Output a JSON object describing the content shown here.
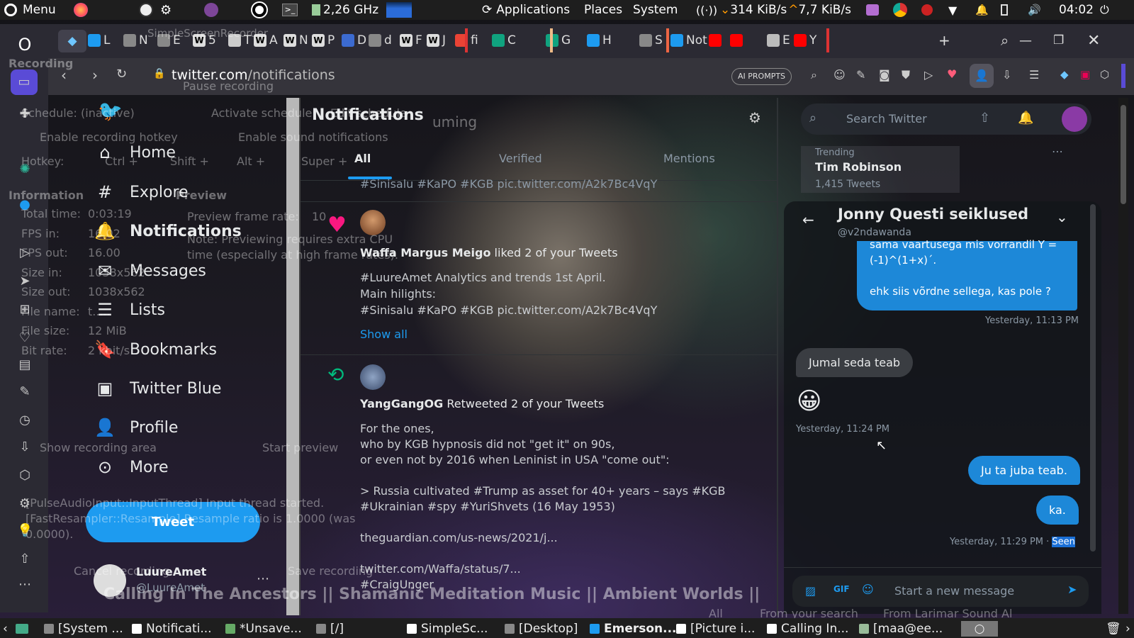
{
  "top_panel": {
    "menu_label": "Menu",
    "cpu_freq": "2,26 GHz",
    "apps": [
      "Applications",
      "Places",
      "System"
    ],
    "net_down": "314 KiB/s",
    "net_up": "7,7 KiB/s",
    "clock": "04:02"
  },
  "browser": {
    "tabs": [
      {
        "icon": "twitter",
        "label": "L"
      },
      {
        "icon": "globe",
        "label": "N"
      },
      {
        "icon": "tab",
        "label": "E"
      },
      {
        "icon": "wiki",
        "label": "5"
      },
      {
        "icon": "pp",
        "label": "T"
      },
      {
        "icon": "wiki",
        "label": "A"
      },
      {
        "icon": "wiki",
        "label": "N"
      },
      {
        "icon": "wiki",
        "label": "P"
      },
      {
        "icon": "x",
        "label": "D"
      },
      {
        "icon": "globe",
        "label": "d"
      },
      {
        "icon": "wiki",
        "label": "F"
      },
      {
        "icon": "wiki",
        "label": "J"
      },
      {
        "icon": "google",
        "label": "fi"
      },
      {
        "icon": "chatgpt",
        "label": "C"
      },
      {
        "icon": "chatgpt",
        "label": "G"
      },
      {
        "icon": "twitter",
        "label": "H"
      },
      {
        "icon": "globe",
        "label": "S"
      },
      {
        "icon": "twitter",
        "label": "Not"
      },
      {
        "icon": "youtube",
        "label": ""
      },
      {
        "icon": "youtube",
        "label": ""
      },
      {
        "icon": "box",
        "label": "E"
      },
      {
        "icon": "youtube",
        "label": "Y"
      }
    ],
    "url_domain": "twitter.com",
    "url_path": "/notifications",
    "ai_prompts_label": "AI PROMPTS"
  },
  "twitter": {
    "nav": [
      {
        "label": "Home",
        "icon": "home-icon"
      },
      {
        "label": "Explore",
        "icon": "hashtag-icon"
      },
      {
        "label": "Notifications",
        "icon": "bell-icon"
      },
      {
        "label": "Messages",
        "icon": "envelope-icon"
      },
      {
        "label": "Lists",
        "icon": "list-icon"
      },
      {
        "label": "Bookmarks",
        "icon": "bookmark-icon"
      },
      {
        "label": "Twitter Blue",
        "icon": "twitter-blue-icon"
      },
      {
        "label": "Profile",
        "icon": "person-icon"
      },
      {
        "label": "More",
        "icon": "more-icon"
      }
    ],
    "tweet_button": "Tweet",
    "account_name": "LuureAmet",
    "account_handle": "@LuureAmet",
    "header_title": "Notifications",
    "tabs": [
      "All",
      "Verified",
      "Mentions"
    ],
    "search_placeholder": "Search Twitter",
    "trending_label": "Trending",
    "trending_name": "Tim Robinson",
    "trending_count": "1,415 Tweets",
    "notifications": {
      "top_clip": "#Sinisalu #KaPO #KGB pic.twitter.com/A2k7Bc4VqY",
      "like_user": "Waffa Margus Meigo",
      "like_action": "liked 2 of your Tweets",
      "like_lines": [
        "#LuureAmet Analytics and trends 1st April.",
        "Main hilights:",
        "#Sinisalu #KaPO #KGB pic.twitter.com/A2k7Bc4VqY"
      ],
      "show_all": "Show all",
      "rt_user": "YangGangOG",
      "rt_action": "Retweeted 2 of your Tweets",
      "rt_lines": [
        "For the ones,",
        "who by KGB hypnosis did not \"get it\" on 90s,",
        "or even not by 2016 when Leninist in USA  \"come out\":",
        "",
        "> Russia cultivated #Trump as asset for 40+ years – says #KGB",
        "#Ukrainian #spy #YuriShvets (16 May 1953)",
        "",
        "theguardian.com/us-news/2021/j...",
        "",
        "twitter.com/Waffa/status/7...",
        "#CraigUnger"
      ]
    },
    "dm": {
      "title": "Jonny Questi seiklused",
      "handle": "@v2ndawanda",
      "msg_top_1": "sama vaartusega mis vorrandil Y =",
      "msg_top_2": "(-1)^(1+x)´.",
      "msg_top_3": "ehk siis võrdne sellega, kas pole ?",
      "ts1": "Yesterday, 11:13 PM",
      "msg_in": "Jumal seda teab",
      "emoji": "😀",
      "ts2": "Yesterday, 11:24 PM",
      "msg_out_1": "Ju ta juba teab.",
      "msg_out_2": "ka.",
      "ts3": "Yesterday, 11:29 PM · ",
      "seen": "Seen",
      "compose_placeholder": "Start a new message"
    }
  },
  "overlay": {
    "app_title": "SimpleScreenRecorder",
    "recording": "Recording",
    "pause": "Pause recording",
    "schedule": "Schedule: (inactive)",
    "activate_schedule": "Activate schedule",
    "edit_schedule": "Edit schedule",
    "enable_hotkey": "Enable recording hotkey",
    "enable_sound": "Enable sound notifications",
    "hotkey": "Hotkey:",
    "ctrl": "Ctrl +",
    "shift": "Shift +",
    "alt": "Alt +",
    "super": "Super +",
    "information": "Information",
    "preview": "Preview",
    "total_time_label": "Total time:",
    "total_time": "0:03:19",
    "fps_in_label": "FPS in:",
    "fps_in": "16.02",
    "fps_out_label": "FPS out:",
    "fps_out": "16.00",
    "size_in_label": "Size in:",
    "size_in": "1038x562",
    "size_out_label": "Size out:",
    "size_out": "1038x562",
    "file_name_label": "File name:",
    "file_name": "t.....",
    "file_size_label": "File size:",
    "file_size": "12 MiB",
    "bit_rate_label": "Bit rate:",
    "bit_rate": "2 kbit/s",
    "preview_rate_label": "Preview frame rate:",
    "preview_rate": "10",
    "note_1": "Note: Previewing requires extra CPU",
    "note_2": "time (especially at high frame rates).",
    "start_preview": "Start preview",
    "show_area": "Show recording area",
    "log_1": "[PulseAudioInput::InputThread] Input thread started.",
    "log_2": "[FastResampler::Resample] Resample ratio is 1.0000 (was",
    "log_3": "0.0000).",
    "cancel": "Cancel recording",
    "save": "Save recording",
    "music_title": "Calling In The Ancestors || Shamanic Meditation Music || Ambient Worlds ||",
    "suming": "uming",
    "all_btn": "All",
    "from_search": "From your search",
    "from_larimar": "From Larimar Sound Al"
  },
  "taskbar": {
    "items": [
      "[System ...",
      "Notificati...",
      "*Unsave...",
      "[/]",
      "SimpleSc...",
      "[Desktop]",
      "Emerson...",
      "[Picture i...",
      "Calling In...",
      "[maa@ee..."
    ]
  }
}
